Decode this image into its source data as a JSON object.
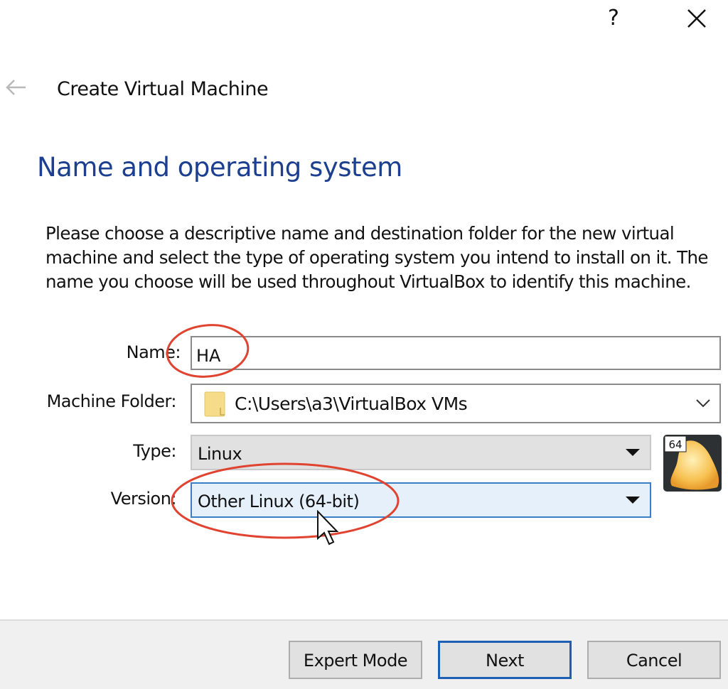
{
  "titlebar": {
    "help_icon": "question-mark-icon",
    "help_label": "?",
    "close_icon": "close-icon"
  },
  "header": {
    "back_icon": "back-arrow-icon",
    "wizard_title": "Create Virtual Machine"
  },
  "page": {
    "heading": "Name and operating system",
    "description": "Please choose a descriptive name and destination folder for the new virtual machine and select the type of operating system you intend to install on it. The name you choose will be used throughout VirtualBox to identify this machine."
  },
  "form": {
    "name": {
      "label": "Name:",
      "value": "HA"
    },
    "machine_folder": {
      "label": "Machine Folder:",
      "value": "C:\\Users\\a3\\VirtualBox VMs",
      "icon": "folder-icon"
    },
    "type": {
      "label": "Type:",
      "value": "Linux"
    },
    "version": {
      "label": "Version:",
      "value": "Other Linux (64-bit)"
    },
    "os_icon": {
      "name": "linux-64-os-icon",
      "badge": "64"
    }
  },
  "annotations": {
    "color": "#e0432f",
    "highlighted": [
      "name-field",
      "version-combo"
    ]
  },
  "footer": {
    "expert_mode": "Expert Mode",
    "next": "Next",
    "cancel": "Cancel"
  },
  "colors": {
    "heading": "#1c3f8f",
    "focus_border": "#1e5fb4",
    "version_bg": "#e6f0fb"
  }
}
